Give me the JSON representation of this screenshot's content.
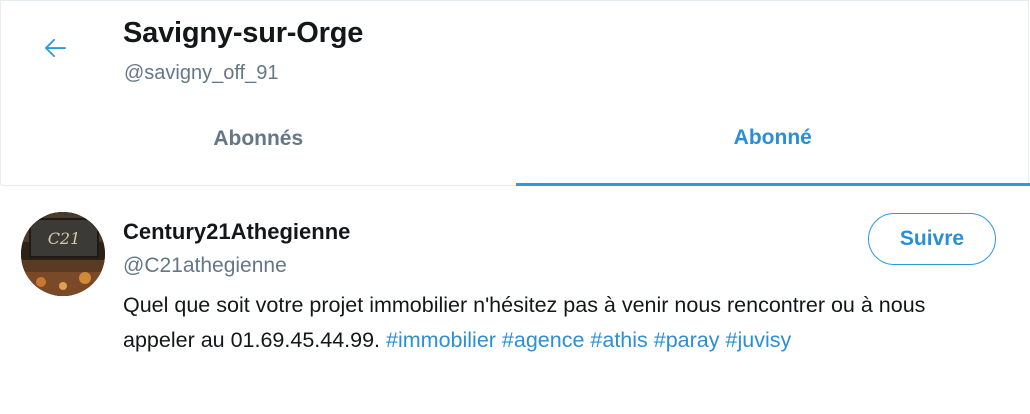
{
  "header": {
    "title": "Savigny-sur-Orge",
    "handle": "@savigny_off_91",
    "back_icon": "arrow-left-icon"
  },
  "tabs": [
    {
      "label": "Abonnés",
      "active": false
    },
    {
      "label": "Abonné",
      "active": true
    }
  ],
  "user": {
    "name": "Century21Athegienne",
    "handle": "@C21athegienne",
    "follow_label": "Suivre",
    "bio_text": "Quel que soit votre projet immobilier n'hésitez pas à venir nous rencontrer ou à nous appeler au 01.69.45.44.99.",
    "hashtags": [
      "#immobilier",
      "#agence",
      "#athis",
      "#paray",
      "#juvisy"
    ],
    "avatar_text": "Century 21"
  },
  "colors": {
    "accent": "#2b8fd6",
    "secondary_text": "#657786",
    "primary_text": "#14171a",
    "border": "#e6ecf0"
  }
}
